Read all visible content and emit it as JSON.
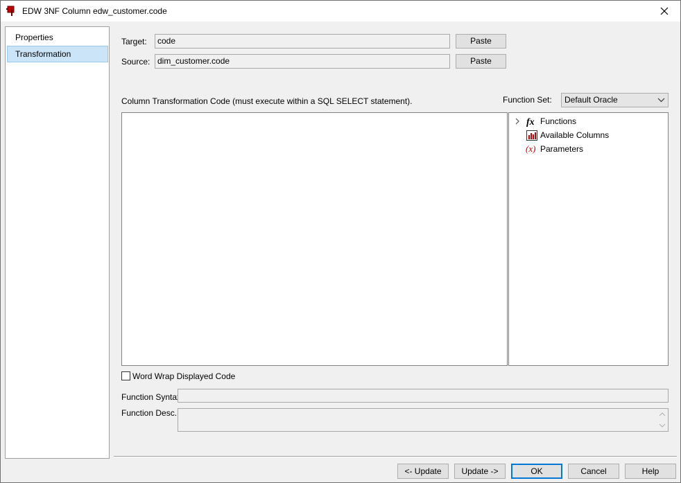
{
  "window": {
    "title": "EDW 3NF Column edw_customer.code"
  },
  "nav": {
    "items": [
      {
        "label": "Properties"
      },
      {
        "label": "Transformation"
      }
    ]
  },
  "target": {
    "label": "Target:",
    "value": "code",
    "paste_label": "Paste"
  },
  "source": {
    "label": "Source:",
    "value": "dim_customer.code",
    "paste_label": "Paste"
  },
  "code": {
    "label": "Column Transformation Code (must execute within a SQL SELECT statement).",
    "value": ""
  },
  "function_set": {
    "label": "Function Set:",
    "selected": "Default Oracle"
  },
  "tree": {
    "items": [
      {
        "label": "Functions",
        "icon": "fx-icon"
      },
      {
        "label": "Available Columns",
        "icon": "columns-chart-icon"
      },
      {
        "label": "Parameters",
        "icon": "parameters-icon"
      }
    ]
  },
  "word_wrap": {
    "label": "Word Wrap Displayed Code",
    "checked": false
  },
  "syntax": {
    "label": "Function Syntax:",
    "value": ""
  },
  "desc": {
    "label": "Function Desc.:",
    "value": ""
  },
  "buttons": {
    "update_prev": "<- Update",
    "update_next": "Update ->",
    "ok": "OK",
    "cancel": "Cancel",
    "help": "Help"
  },
  "colors": {
    "selection": "#cce4f7",
    "default_button_border": "#0078d7",
    "icon_red": "#c00000"
  }
}
